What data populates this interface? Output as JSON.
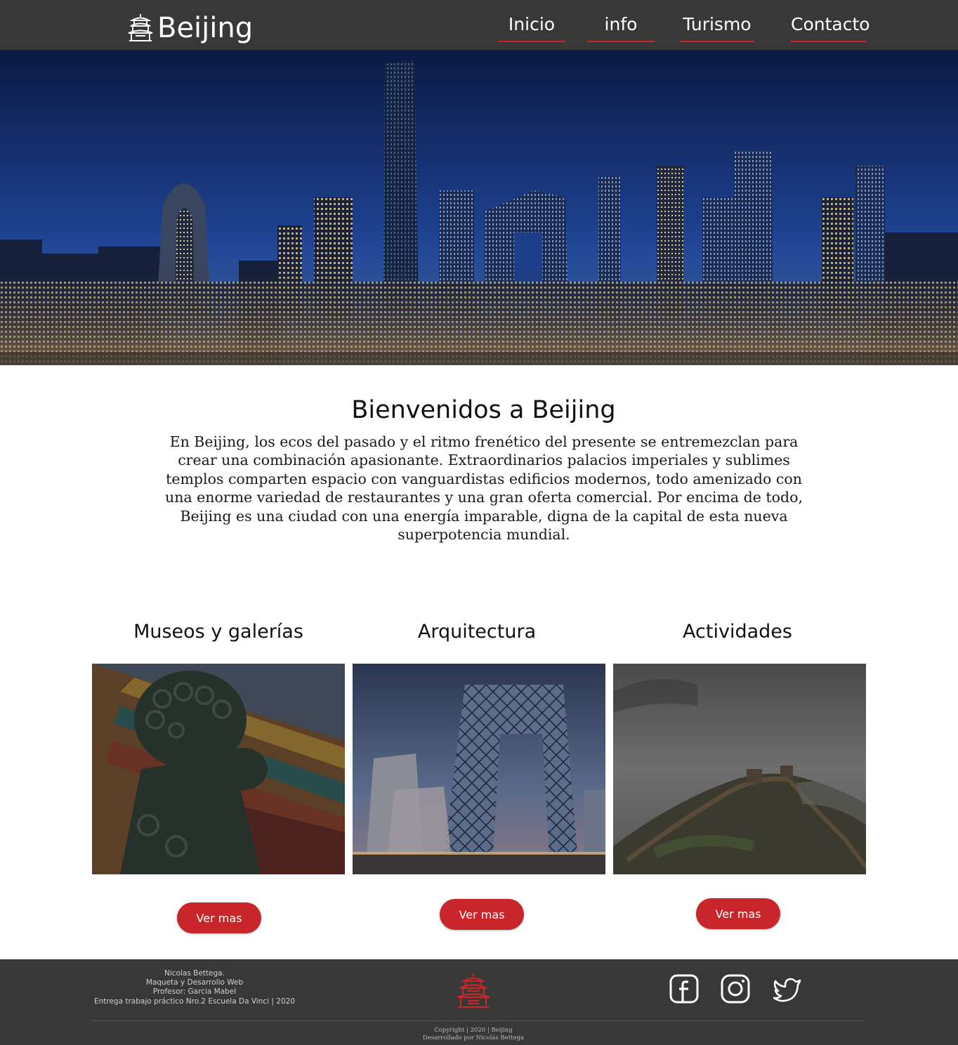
{
  "brand": {
    "name": "Beijing",
    "logo_icon": "pagoda-icon",
    "accent": "#c8262a",
    "header_bg": "#383838"
  },
  "nav": [
    {
      "label": "Inicio"
    },
    {
      "label": "info"
    },
    {
      "label": "Turismo"
    },
    {
      "label": "Contacto"
    }
  ],
  "welcome": {
    "title": "Bienvenidos a Beijing",
    "text": "En Beijing, los ecos del pasado y el ritmo frenético del presente se entremezclan para crear una combinación apasionante. Extraordinarios palacios imperiales y sublimes templos comparten espacio con vanguardistas edificios modernos, todo amenizado con una enorme variedad de restaurantes y una gran oferta comercial. Por encima de todo, Beijing es una ciudad con una energía imparable, digna de la capital de esta nueva superpotencia mundial."
  },
  "cards": [
    {
      "title": "Museos y galerías",
      "button": "Ver mas"
    },
    {
      "title": "Arquitectura",
      "button": "Ver mas"
    },
    {
      "title": "Actividades",
      "button": "Ver mas"
    }
  ],
  "footer": {
    "credits": [
      "Nicolas Bettega.",
      "Maqueta  y Desarrollo Web",
      "Profesor: Garcia Mabel",
      "Entrega trabajo práctico Nro.2 Escuela Da Vinci  |  2020"
    ],
    "social": [
      {
        "name": "facebook-icon"
      },
      {
        "name": "instagram-icon"
      },
      {
        "name": "twitter-icon"
      }
    ],
    "copyright": "Copyright | 2020 | Beijing",
    "developer": "Desarrollado por Nicolás Bettega"
  }
}
